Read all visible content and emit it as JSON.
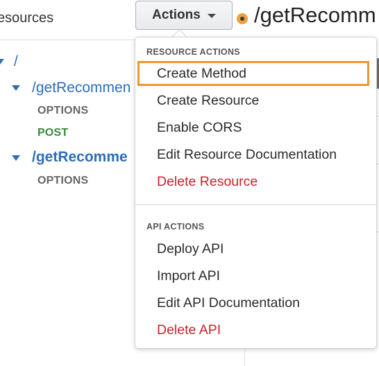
{
  "panel": {
    "title": "esources"
  },
  "tree": {
    "root": "/",
    "resource1": "/getRecommen",
    "resource1_methods": [
      "OPTIONS",
      "POST"
    ],
    "resource2": "/getRecomme",
    "resource2_methods": [
      "OPTIONS"
    ]
  },
  "header": {
    "path": "/getRecomm"
  },
  "actions_button": {
    "label": "Actions"
  },
  "dropdown": {
    "resource_section": "RESOURCE ACTIONS",
    "resource_items": [
      "Create Method",
      "Create Resource",
      "Enable CORS",
      "Edit Resource Documentation",
      "Delete Resource"
    ],
    "api_section": "API ACTIONS",
    "api_items": [
      "Deploy API",
      "Import API",
      "Edit API Documentation",
      "Delete API"
    ]
  },
  "colors": {
    "link": "#2f6db5",
    "post": "#3a8a3a",
    "danger": "#c8232c",
    "highlight": "#f0962e"
  }
}
